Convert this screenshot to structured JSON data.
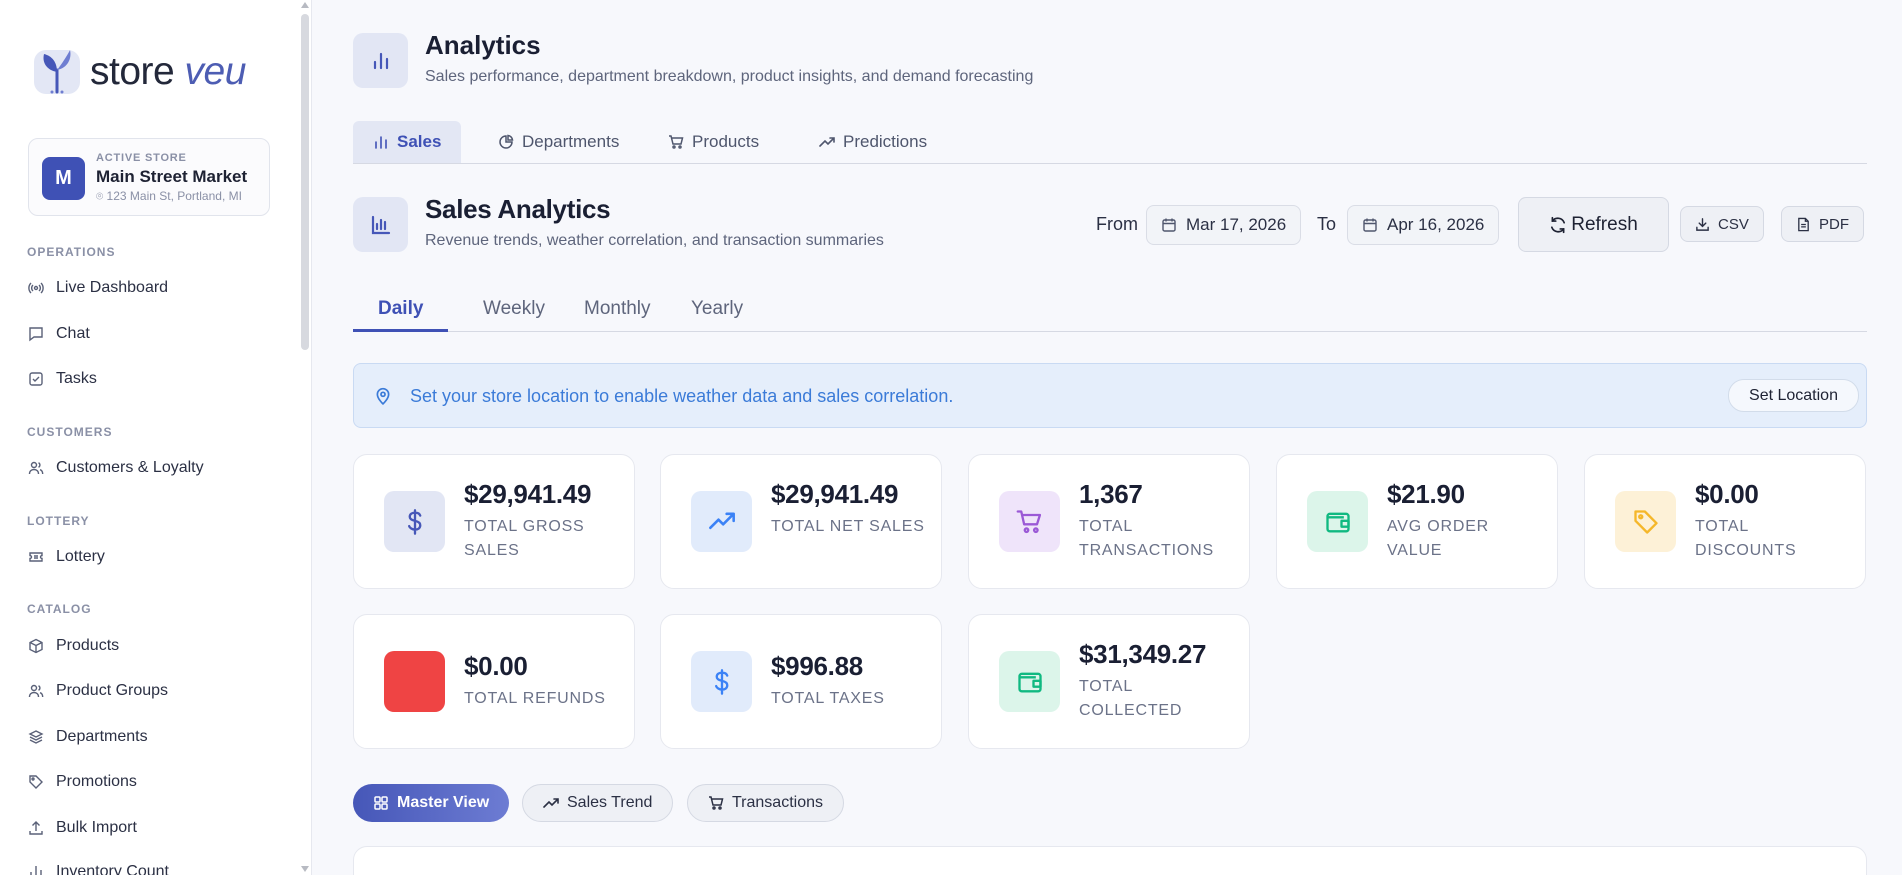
{
  "brand": {
    "name_primary": "store",
    "name_accent": "veu"
  },
  "store": {
    "caption": "ACTIVE STORE",
    "initial": "M",
    "name": "Main Street Market",
    "address": "123 Main St, Portland, MI"
  },
  "sidebar": {
    "sections": [
      {
        "title": "OPERATIONS",
        "items": [
          {
            "label": "Live Dashboard",
            "icon": "broadcast-icon"
          },
          {
            "label": "Chat",
            "icon": "chat-icon"
          },
          {
            "label": "Tasks",
            "icon": "checkbox-icon"
          }
        ]
      },
      {
        "title": "CUSTOMERS",
        "items": [
          {
            "label": "Customers & Loyalty",
            "icon": "users-icon"
          }
        ]
      },
      {
        "title": "LOTTERY",
        "items": [
          {
            "label": "Lottery",
            "icon": "ticket-icon"
          }
        ]
      },
      {
        "title": "CATALOG",
        "items": [
          {
            "label": "Products",
            "icon": "box-icon"
          },
          {
            "label": "Product Groups",
            "icon": "users-icon"
          },
          {
            "label": "Departments",
            "icon": "layers-icon"
          },
          {
            "label": "Promotions",
            "icon": "tag-icon"
          },
          {
            "label": "Bulk Import",
            "icon": "upload-icon"
          },
          {
            "label": "Inventory Count",
            "icon": "count-icon"
          }
        ]
      }
    ]
  },
  "header": {
    "title": "Analytics",
    "subtitle": "Sales performance, department breakdown, product insights, and demand forecasting"
  },
  "tabs": [
    {
      "label": "Sales",
      "icon": "bar-chart-icon"
    },
    {
      "label": "Departments",
      "icon": "pie-chart-icon"
    },
    {
      "label": "Products",
      "icon": "cart-icon"
    },
    {
      "label": "Predictions",
      "icon": "trend-icon"
    }
  ],
  "section": {
    "title": "Sales Analytics",
    "subtitle": "Revenue trends, weather correlation, and transaction summaries"
  },
  "toolbar": {
    "from_label": "From",
    "from_date": "Mar 17, 2026",
    "to_label": "To",
    "to_date": "Apr 16, 2026",
    "refresh": "Refresh",
    "csv": "CSV",
    "pdf": "PDF"
  },
  "periods": [
    "Daily",
    "Weekly",
    "Monthly",
    "Yearly"
  ],
  "banner": {
    "text": "Set your store location to enable weather data and sales correlation.",
    "button": "Set Location"
  },
  "stats": [
    {
      "value": "$29,941.49",
      "label": "TOTAL GROSS SALES",
      "icon": "dollar-icon",
      "color": "#4657b8"
    },
    {
      "value": "$29,941.49",
      "label": "TOTAL NET SALES",
      "icon": "trend-up-icon",
      "color": "#3b82f6"
    },
    {
      "value": "1,367",
      "label": "TOTAL TRANSACTIONS",
      "icon": "cart-icon",
      "color": "#9b59d6"
    },
    {
      "value": "$21.90",
      "label": "AVG ORDER VALUE",
      "icon": "wallet-icon",
      "color": "#10b981"
    },
    {
      "value": "$0.00",
      "label": "TOTAL DISCOUNTS",
      "icon": "tag-icon",
      "color": "#f5b72a"
    },
    {
      "value": "$0.00",
      "label": "TOTAL REFUNDS",
      "icon": "refund-icon",
      "color": "#ef4444"
    },
    {
      "value": "$996.88",
      "label": "TOTAL TAXES",
      "icon": "dollar-icon",
      "color": "#3b82f6"
    },
    {
      "value": "$31,349.27",
      "label": "TOTAL COLLECTED",
      "icon": "wallet-icon",
      "color": "#10b981"
    }
  ],
  "views": [
    {
      "label": "Master View",
      "icon": "grid-icon"
    },
    {
      "label": "Sales Trend",
      "icon": "trend-icon"
    },
    {
      "label": "Transactions",
      "icon": "cart-icon"
    }
  ]
}
